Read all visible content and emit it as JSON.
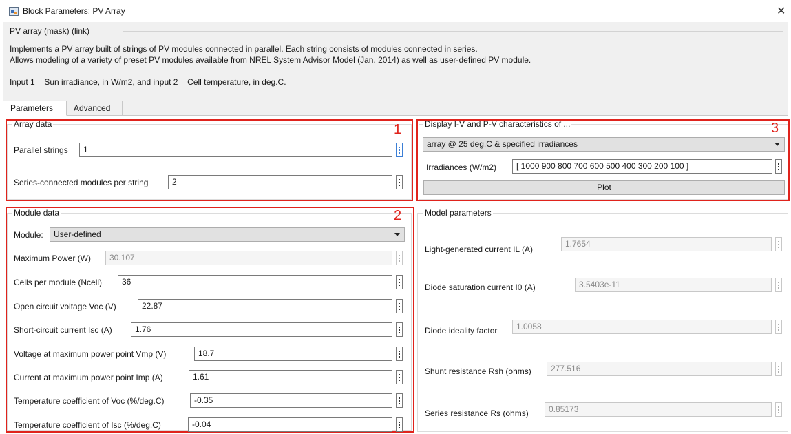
{
  "window": {
    "title": "Block Parameters: PV Array"
  },
  "mask": {
    "title": "PV array (mask) (link)",
    "description": [
      "Implements a PV array built of strings of PV modules connected in parallel. Each string consists of modules connected in series.",
      "Allows modeling of a variety of preset PV modules available from NREL System Advisor Model (Jan. 2014) as well as user-defined PV module.",
      "Input 1 = Sun irradiance, in W/m2, and input 2 = Cell temperature, in deg.C."
    ]
  },
  "tabs": [
    {
      "label": "Parameters",
      "active": true
    },
    {
      "label": "Advanced",
      "active": false
    }
  ],
  "annotations": {
    "one": "1",
    "two": "2",
    "three": "3",
    "color": "#e0231c"
  },
  "array_data": {
    "title": "Array data",
    "parallel_label": "Parallel strings",
    "parallel_value": "1",
    "series_label": "Series-connected modules per string",
    "series_value": "2"
  },
  "module_data": {
    "title": "Module data",
    "module_label": "Module:",
    "module_value": "User-defined",
    "rows": [
      {
        "label": "Maximum Power (W)",
        "value": "30.107"
      },
      {
        "label": "Cells per module (Ncell)",
        "value": "36"
      },
      {
        "label": "Open circuit voltage  Voc (V)",
        "value": "22.87"
      },
      {
        "label": "Short-circuit current Isc (A)",
        "value": "1.76"
      },
      {
        "label": "Voltage at maximum power point Vmp (V)",
        "value": "18.7"
      },
      {
        "label": "Current at maximum power point Imp (A)",
        "value": "1.61"
      },
      {
        "label": "Temperature coefficient of Voc (%/deg.C)",
        "value": "-0.35"
      },
      {
        "label": "Temperature coefficient of Isc (%/deg.C)",
        "value": "-0.04"
      }
    ]
  },
  "display": {
    "title": "Display  I-V and P-V characteristics of ...",
    "select_value": "array @ 25 deg.C & specified irradiances",
    "irr_label": "Irradiances (W/m2)",
    "irr_value": "[ 1000 900 800 700 600  500 400 300 200 100 ]",
    "plot_label": "Plot"
  },
  "model_params": {
    "title": "Model parameters",
    "rows": [
      {
        "label": "Light-generated current IL (A)",
        "value": "1.7654"
      },
      {
        "label": "Diode saturation current I0 (A)",
        "value": "3.5403e-11"
      },
      {
        "label": "Diode ideality factor",
        "value": "1.0058"
      },
      {
        "label": "Shunt resistance Rsh (ohms)",
        "value": "277.516"
      },
      {
        "label": "Series resistance Rs (ohms)",
        "value": "0.85173"
      }
    ]
  }
}
